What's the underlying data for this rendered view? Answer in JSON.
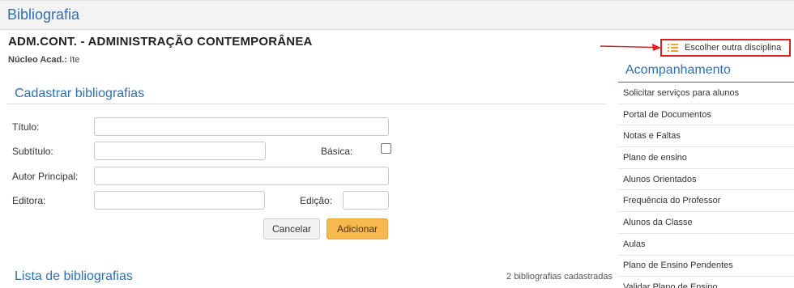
{
  "header": {
    "title": "Bibliografia"
  },
  "course": {
    "title": "ADM.CONT. - ADMINISTRAÇÃO CONTEMPORÂNEA",
    "nucleo_label": "Núcleo Acad.:",
    "nucleo_value": "Ite"
  },
  "choose_discipline": {
    "label": "Escolher outra disciplina",
    "icon": "list-icon",
    "border_color": "#d9201f"
  },
  "form": {
    "section_title": "Cadastrar bibliografias",
    "titulo_label": "Título:",
    "subtitulo_label": "Subtítulo:",
    "basica_label": "Básica:",
    "autor_label": "Autor Principal:",
    "editora_label": "Editora:",
    "edicao_label": "Edição:",
    "titulo_value": "",
    "subtitulo_value": "",
    "autor_value": "",
    "editora_value": "",
    "edicao_value": "",
    "basica_checked": false,
    "cancel_label": "Cancelar",
    "add_label": "Adicionar"
  },
  "list": {
    "title": "Lista de bibliografias",
    "count_text": "2 bibliografias cadastradas"
  },
  "sidebar": {
    "title": "Acompanhamento",
    "items": [
      "Solicitar serviços para alunos",
      "Portal de Documentos",
      "Notas e Faltas",
      "Plano de ensino",
      "Alunos Orientados",
      "Frequência do Professor",
      "Alunos da Classe",
      "Aulas",
      "Plano de Ensino Pendentes",
      "Validar Plano de Ensino"
    ]
  },
  "colors": {
    "accent": "#2f6fb0",
    "add_button": "#f7b84e",
    "arrow": "#d9201f"
  }
}
